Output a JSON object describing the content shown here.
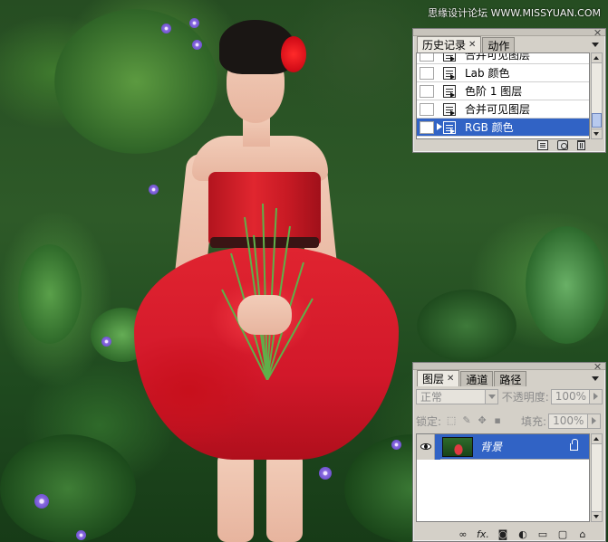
{
  "watermark": "思缘设计论坛 WWW.MISSYUAN.COM",
  "history_panel": {
    "tabs": [
      {
        "label": "历史记录",
        "active": true,
        "has_close": true
      },
      {
        "label": "动作",
        "active": false,
        "has_close": false
      }
    ],
    "items": [
      {
        "label": "合并可见图层",
        "selected": false
      },
      {
        "label": "Lab 颜色",
        "selected": false
      },
      {
        "label": "色阶 1 图层",
        "selected": false
      },
      {
        "label": "合并可见图层",
        "selected": false
      },
      {
        "label": "RGB 颜色",
        "selected": true
      }
    ],
    "footer_icons": [
      "new-document-from-state-icon",
      "new-snapshot-icon",
      "delete-state-icon"
    ]
  },
  "layers_panel": {
    "tabs": [
      {
        "label": "图层",
        "active": true,
        "has_close": true
      },
      {
        "label": "通道",
        "active": false,
        "has_close": false
      },
      {
        "label": "路径",
        "active": false,
        "has_close": false
      }
    ],
    "blend_mode": "正常",
    "opacity_label": "不透明度:",
    "opacity_value": "100%",
    "lock_label": "锁定:",
    "fill_label": "填充:",
    "fill_value": "100%",
    "layers": [
      {
        "name": "背景",
        "visible": true,
        "locked": true,
        "selected": true
      }
    ],
    "footer_icons": [
      "link-layers-icon",
      "fx-icon",
      "layer-mask-icon",
      "adjustment-layer-icon",
      "new-group-icon",
      "new-layer-icon",
      "delete-layer-icon"
    ],
    "footer_fx": "fx."
  },
  "colors": {
    "selection_blue": "#3163c5",
    "panel_bg": "#d4d0c8",
    "dress_red": "#e0262f"
  }
}
